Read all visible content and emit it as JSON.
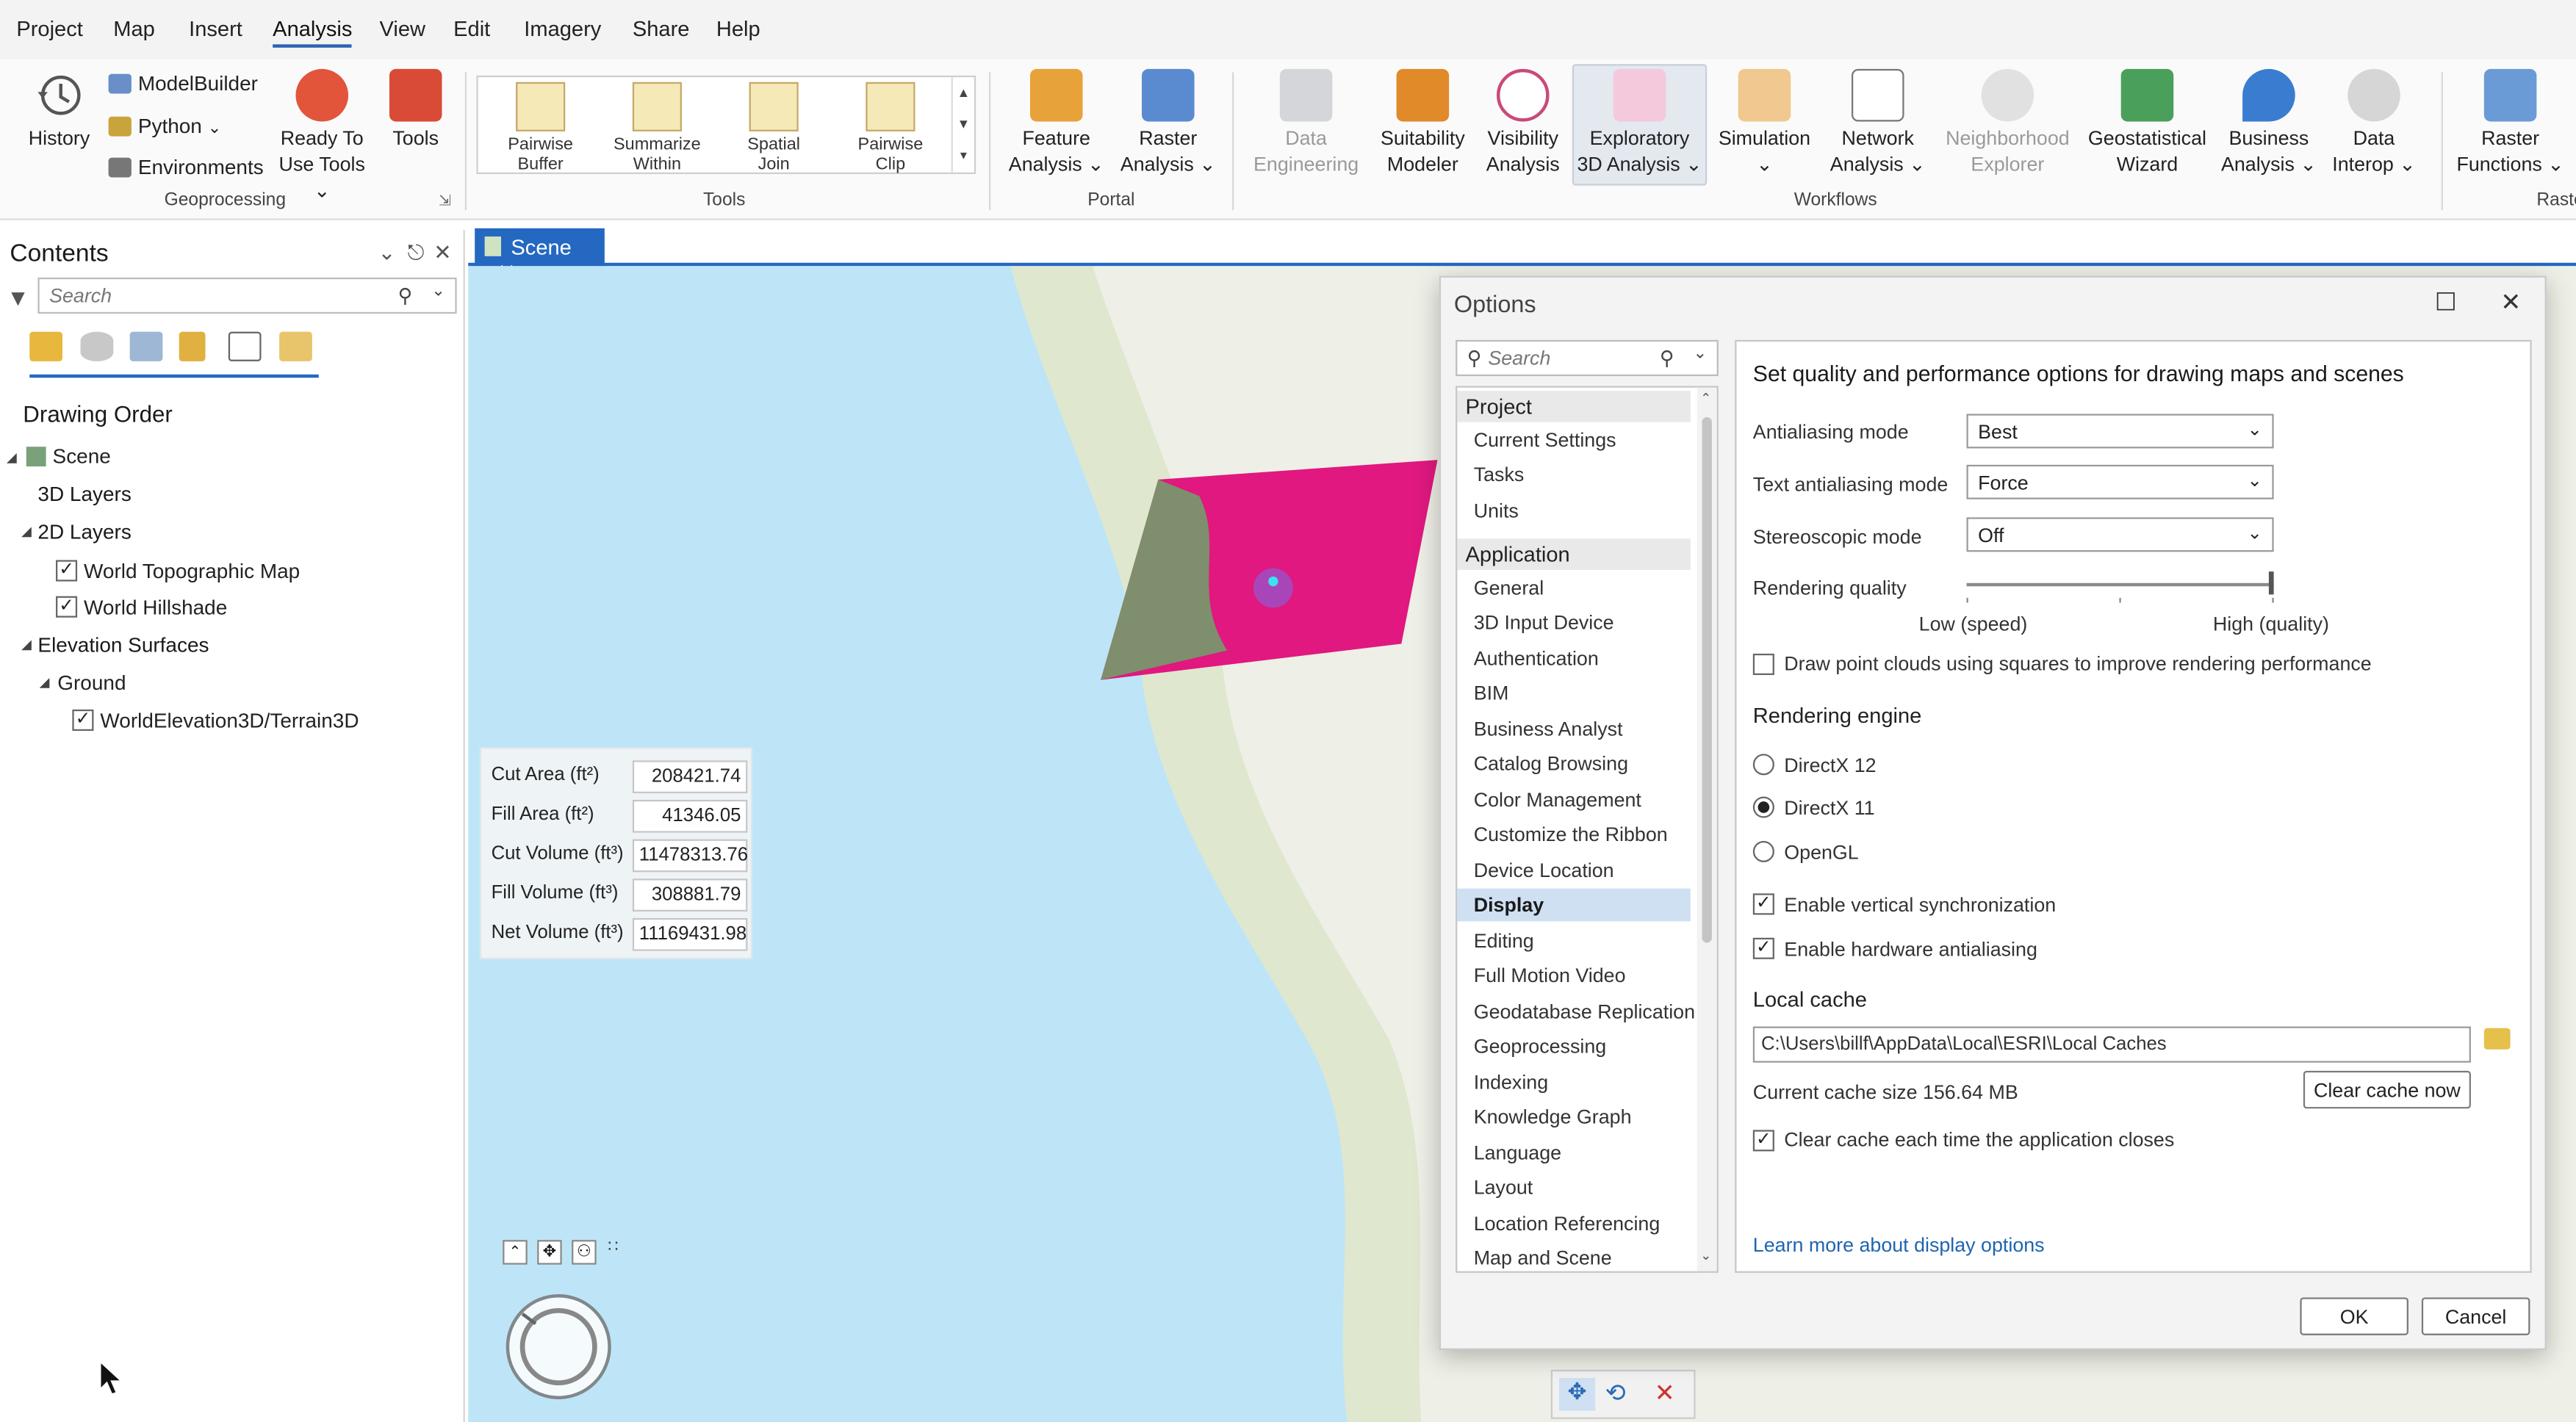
{
  "menubar": {
    "items": [
      "Project",
      "Map",
      "Insert",
      "Analysis",
      "View",
      "Edit",
      "Imagery",
      "Share",
      "Help"
    ],
    "active": "Analysis"
  },
  "ribbon": {
    "geoprocessing": {
      "history": "History",
      "modelbuilder": "ModelBuilder",
      "python": "Python",
      "environments": "Environments",
      "ready_line1": "Ready To",
      "ready_line2": "Use Tools",
      "tools": "Tools",
      "label": "Geoprocessing"
    },
    "tools": {
      "gallery": [
        {
          "line1": "Pairwise",
          "line2": "Buffer"
        },
        {
          "line1": "Summarize",
          "line2": "Within"
        },
        {
          "line1": "Spatial",
          "line2": "Join"
        },
        {
          "line1": "Pairwise",
          "line2": "Clip"
        }
      ],
      "label": "Tools"
    },
    "portal": {
      "feature_line1": "Feature",
      "feature_line2": "Analysis",
      "raster_line1": "Raster",
      "raster_line2": "Analysis",
      "label": "Portal"
    },
    "workflows": {
      "items": [
        {
          "line1": "Data",
          "line2": "Engineering",
          "dim": true
        },
        {
          "line1": "Suitability",
          "line2": "Modeler",
          "dim": false
        },
        {
          "line1": "Visibility",
          "line2": "Analysis",
          "dim": false
        },
        {
          "line1": "Exploratory",
          "line2": "3D Analysis",
          "dim": false
        },
        {
          "line1": "Simulation",
          "line2": "",
          "dim": false
        },
        {
          "line1": "Network",
          "line2": "Analysis",
          "dim": false
        },
        {
          "line1": "Neighborhood",
          "line2": "Explorer",
          "dim": true
        },
        {
          "line1": "Geostatistical",
          "line2": "Wizard",
          "dim": false
        },
        {
          "line1": "Business",
          "line2": "Analysis",
          "dim": false
        },
        {
          "line1": "Data",
          "line2": "Interop",
          "dim": false
        }
      ],
      "label": "Workflows"
    },
    "raster": {
      "line1": "Raster",
      "line2": "Functions",
      "label": "Raste"
    }
  },
  "contents": {
    "title": "Contents",
    "search_placeholder": "Search",
    "drawing_order": "Drawing Order",
    "tree": {
      "scene": "Scene",
      "layers3d": "3D Layers",
      "layers2d": "2D Layers",
      "topo": "World Topographic Map",
      "hillshade": "World Hillshade",
      "elevation": "Elevation Surfaces",
      "ground": "Ground",
      "terrain": "WorldElevation3D/Terrain3D"
    }
  },
  "scene_tab": {
    "label": "Scene"
  },
  "cutfill": {
    "rows": [
      {
        "label": "Cut Area (ft²)",
        "value": "208421.74"
      },
      {
        "label": "Fill Area (ft²)",
        "value": "41346.05"
      },
      {
        "label": "Cut Volume (ft³)",
        "value": "11478313.76"
      },
      {
        "label": "Fill Volume (ft³)",
        "value": "308881.79"
      },
      {
        "label": "Net Volume (ft³)",
        "value": "11169431.98"
      }
    ]
  },
  "options": {
    "title": "Options",
    "search_placeholder": "Search",
    "nav": {
      "project_head": "Project",
      "project_items": [
        "Current Settings",
        "Tasks",
        "Units"
      ],
      "app_head": "Application",
      "app_items": [
        "General",
        "3D Input Device",
        "Authentication",
        "BIM",
        "Business Analyst",
        "Catalog Browsing",
        "Color Management",
        "Customize the Ribbon",
        "Device Location",
        "Display",
        "Editing",
        "Full Motion Video",
        "Geodatabase Replication",
        "Geoprocessing",
        "Indexing",
        "Knowledge Graph",
        "Language",
        "Layout",
        "Location Referencing",
        "Map and Scene"
      ],
      "selected": "Display"
    },
    "heading": "Set quality and performance options for drawing maps and scenes",
    "antialiasing_label": "Antialiasing mode",
    "antialiasing_value": "Best",
    "text_aa_label": "Text antialiasing mode",
    "text_aa_value": "Force",
    "stereo_label": "Stereoscopic mode",
    "stereo_value": "Off",
    "rendering_quality_label": "Rendering quality",
    "rendering_quality_level": 1.0,
    "low_label": "Low (speed)",
    "high_label": "High (quality)",
    "point_clouds": "Draw point clouds using squares to improve rendering performance",
    "engine_head": "Rendering engine",
    "engines": [
      "DirectX 12",
      "DirectX 11",
      "OpenGL"
    ],
    "engine_selected": "DirectX 11",
    "vsync": "Enable vertical synchronization",
    "hw_aa": "Enable hardware antialiasing",
    "cache_head": "Local cache",
    "cache_path": "C:\\Users\\billf\\AppData\\Local\\ESRI\\Local Caches",
    "cache_size": "Current cache size 156.64 MB",
    "clear_cache_btn": "Clear cache now",
    "clear_on_close": "Clear cache each time the application closes",
    "learn_more": "Learn more about display options",
    "ok": "OK",
    "cancel": "Cancel"
  },
  "colors": {
    "accent": "#2468c2",
    "water": "#bde5f7",
    "land": "#eeefe6",
    "polygon": "#e0187f"
  }
}
